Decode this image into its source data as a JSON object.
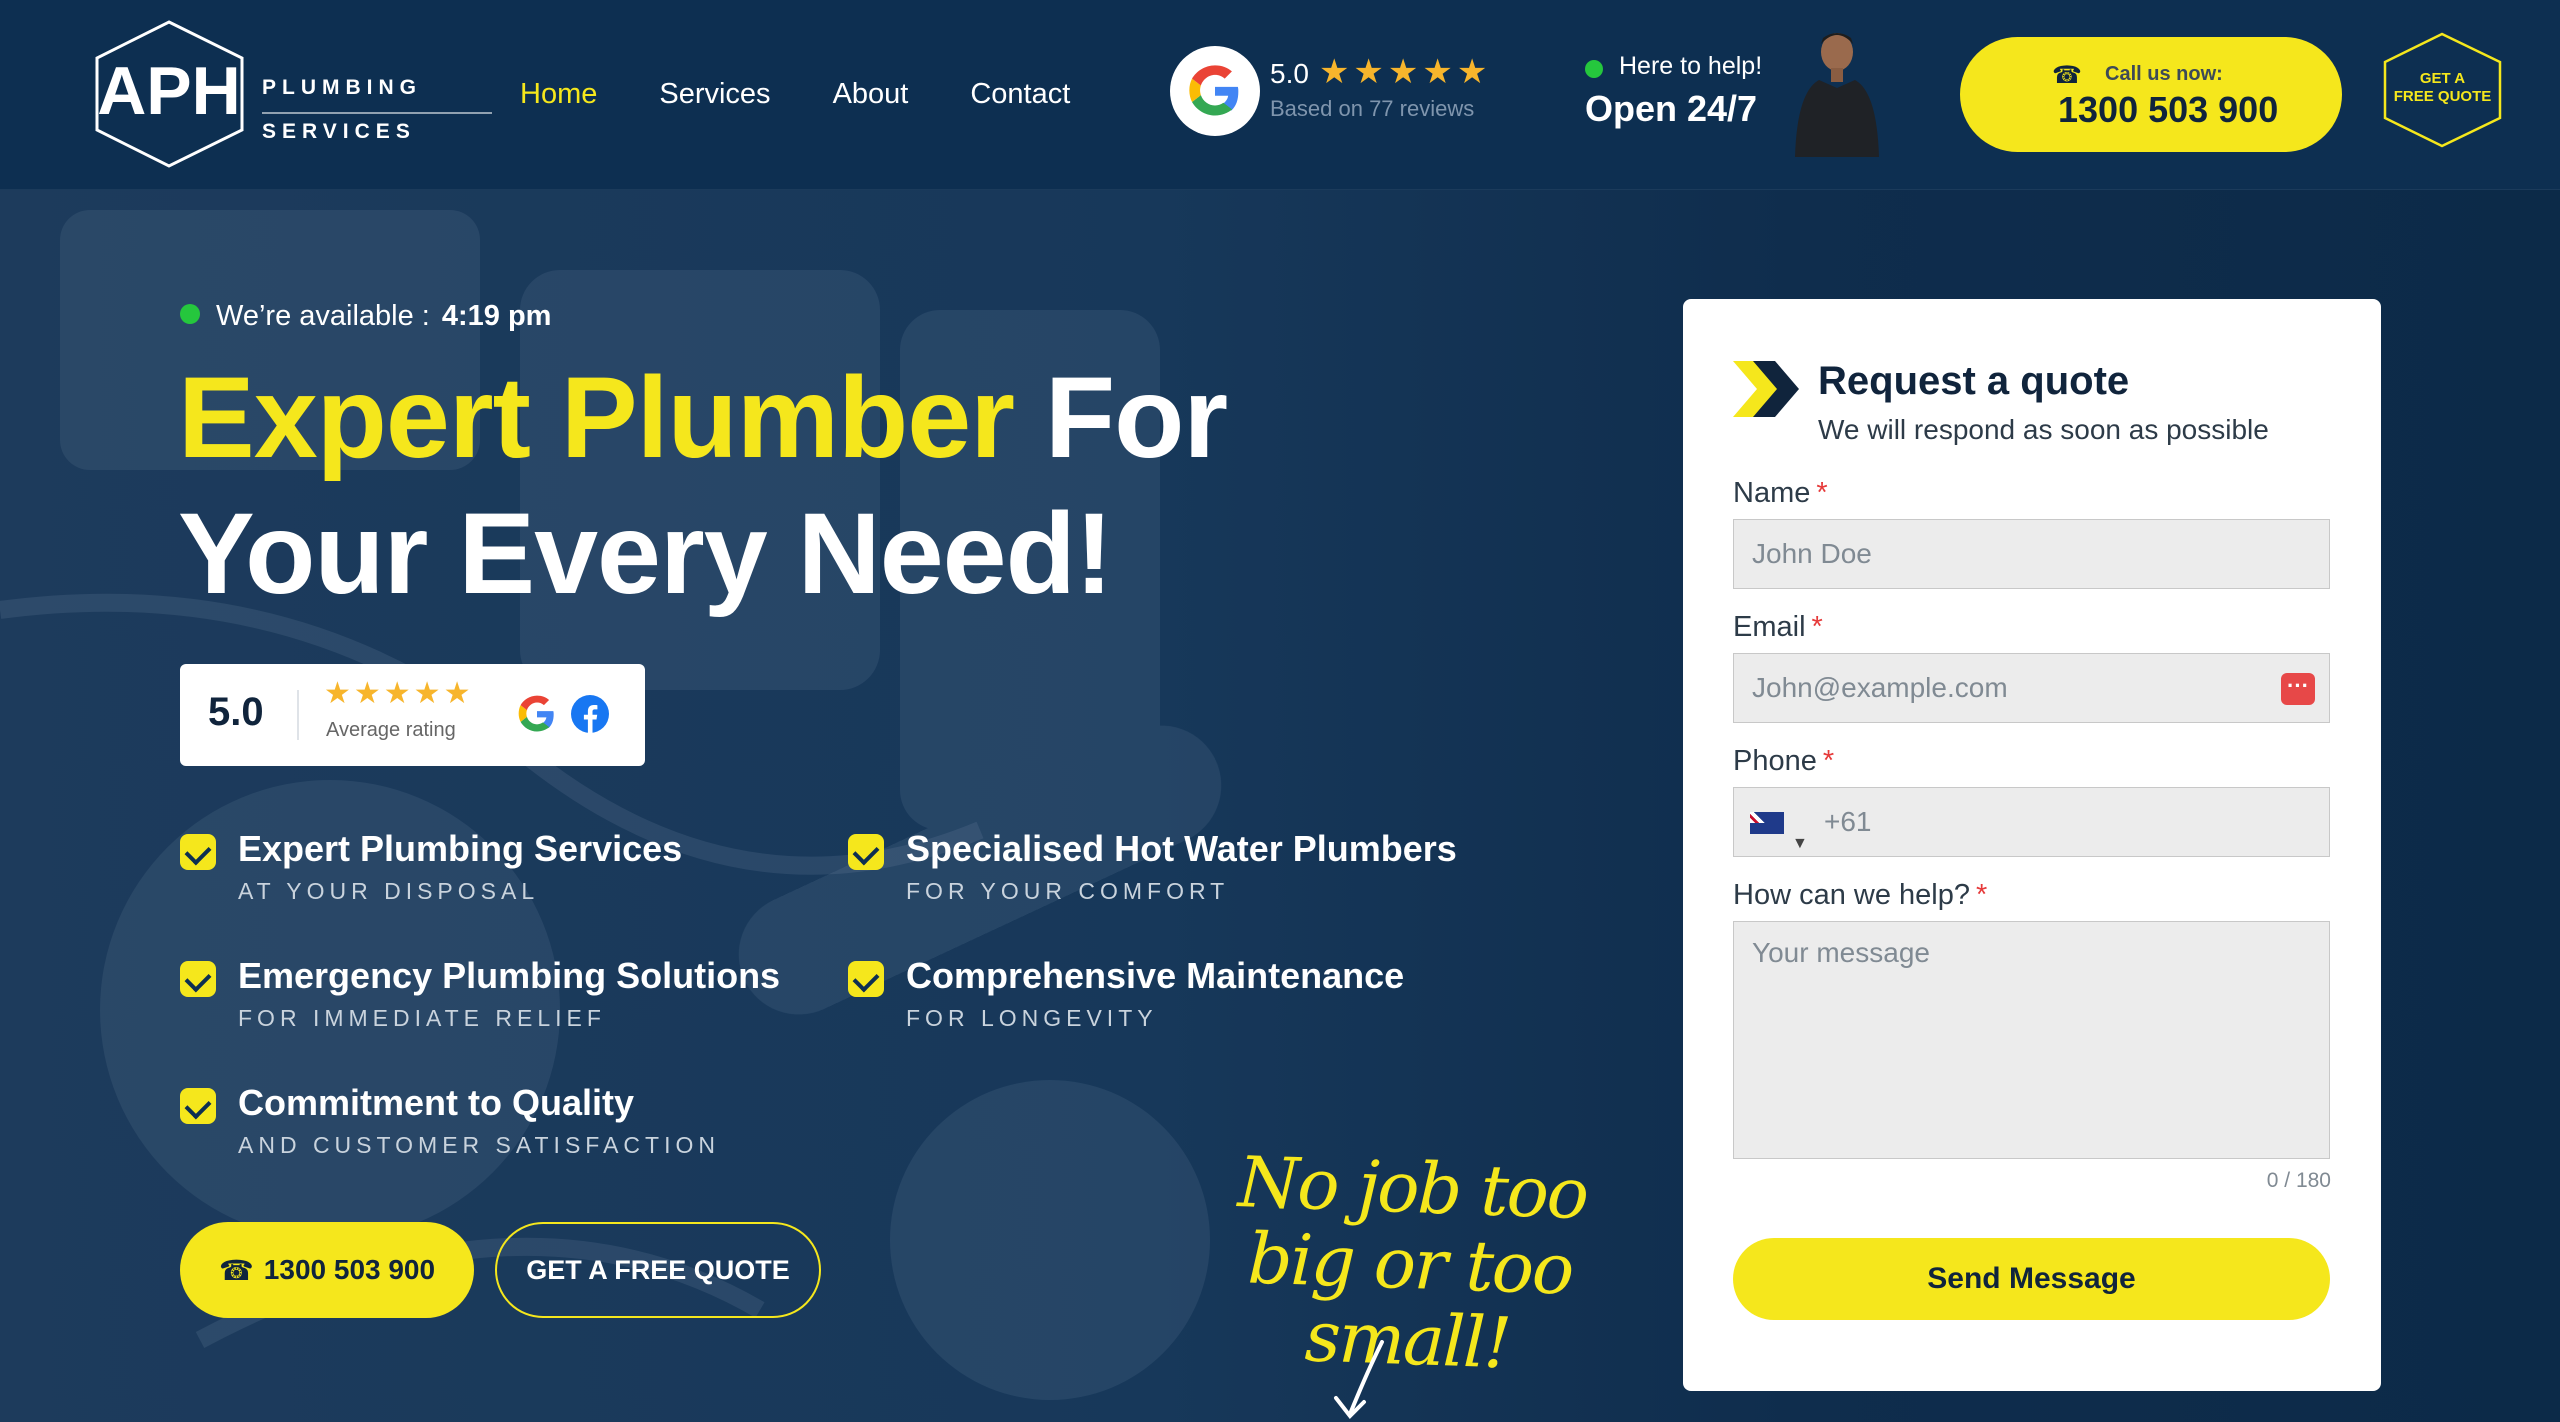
{
  "header": {
    "logo_mark": "APH",
    "logo_line1": "PLUMBING",
    "logo_line2": "SERVICES",
    "nav": [
      {
        "label": "Home",
        "active": true
      },
      {
        "label": "Services",
        "active": false
      },
      {
        "label": "About",
        "active": false
      },
      {
        "label": "Contact",
        "active": false
      }
    ],
    "google_rating": {
      "score": "5.0",
      "stars": "★★★★★",
      "based": "Based on 77 reviews"
    },
    "help": {
      "small": "Here to help!",
      "big": "Open 24/7"
    },
    "call": {
      "label": "Call us now:",
      "number": "1300 503 900",
      "icon": "phone-icon"
    },
    "quote_badge": {
      "line1": "GET A",
      "line2": "FREE QUOTE"
    }
  },
  "hero": {
    "available_label": "We’re available :",
    "available_time": "4:19 pm",
    "headline_yellow": "Expert Plumber",
    "headline_white1": " For",
    "headline_white2": "Your Every Need!",
    "rating_card": {
      "score": "5.0",
      "stars": "★★★★★",
      "caption": "Average rating"
    },
    "features": [
      {
        "title": "Expert Plumbing Services",
        "sub": "AT YOUR DISPOSAL"
      },
      {
        "title": "Specialised Hot Water Plumbers",
        "sub": "FOR YOUR COMFORT"
      },
      {
        "title": "Emergency Plumbing Solutions",
        "sub": "FOR IMMEDIATE RELIEF"
      },
      {
        "title": "Comprehensive Maintenance",
        "sub": "FOR LONGEVITY"
      },
      {
        "title": "Commitment to Quality",
        "sub": "AND CUSTOMER SATISFACTION"
      }
    ],
    "call_button": "1300 503 900",
    "quote_button": "GET A FREE QUOTE",
    "script_line1": "No job too",
    "script_line2": "big or too small!"
  },
  "form": {
    "title": "Request a quote",
    "subtitle": "We will respond as soon as possible",
    "name_label": "Name",
    "name_placeholder": "John Doe",
    "email_label": "Email",
    "email_placeholder": "John@example.com",
    "phone_label": "Phone",
    "phone_code": "+61",
    "message_label": "How can we help?",
    "message_placeholder": "Your message",
    "counter": "0 / 180",
    "required_mark": "*",
    "submit": "Send Message"
  },
  "colors": {
    "navy": "#0d2f51",
    "yellow": "#f5e71c",
    "green": "#25c73d",
    "star": "#f7b52c"
  }
}
